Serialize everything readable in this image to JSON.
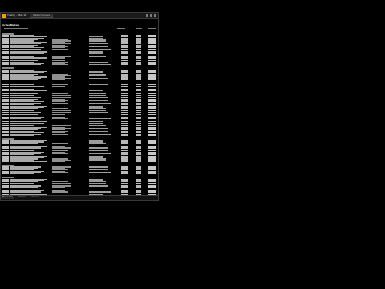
{
  "window": {
    "title": "Trading - Wide 1D",
    "tab_label": "Market Overview"
  },
  "section": {
    "header": "Active Markets"
  },
  "footer": {
    "tabs": [
      {
        "label": "Market Data"
      },
      {
        "label": "Watchlist"
      },
      {
        "label": "Positions"
      }
    ]
  },
  "colors": {
    "background": "#000000",
    "text": "#cfcfcf",
    "accent_orange": "#e8a020",
    "accent_green": "#3cb371",
    "accent_red": "#d04040",
    "accent_blue": "#4a78c8"
  }
}
